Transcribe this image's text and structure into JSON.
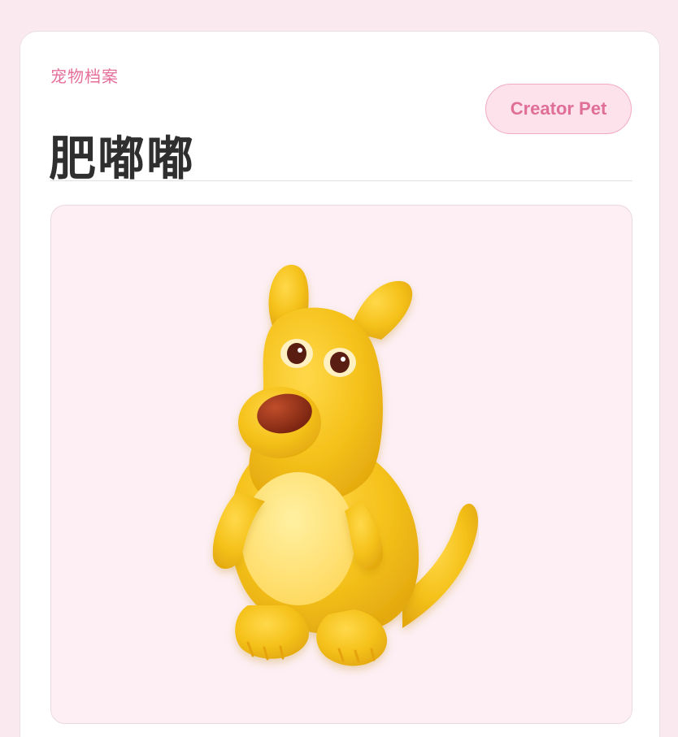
{
  "profile": {
    "section_label": "宠物档案",
    "pet_name": "肥嘟嘟",
    "badge_label": "Creator Pet"
  },
  "image": {
    "name": "yellow-kangaroo-pet"
  },
  "colors": {
    "background": "#fbe9f0",
    "card": "#ffffff",
    "accent": "#e66f9a",
    "badge_fill": "#fde1eb",
    "image_panel": "#fdeff4",
    "pet_yellow": "#f7c51e",
    "pet_belly": "#ffe27a",
    "pet_nose": "#9b341b"
  }
}
